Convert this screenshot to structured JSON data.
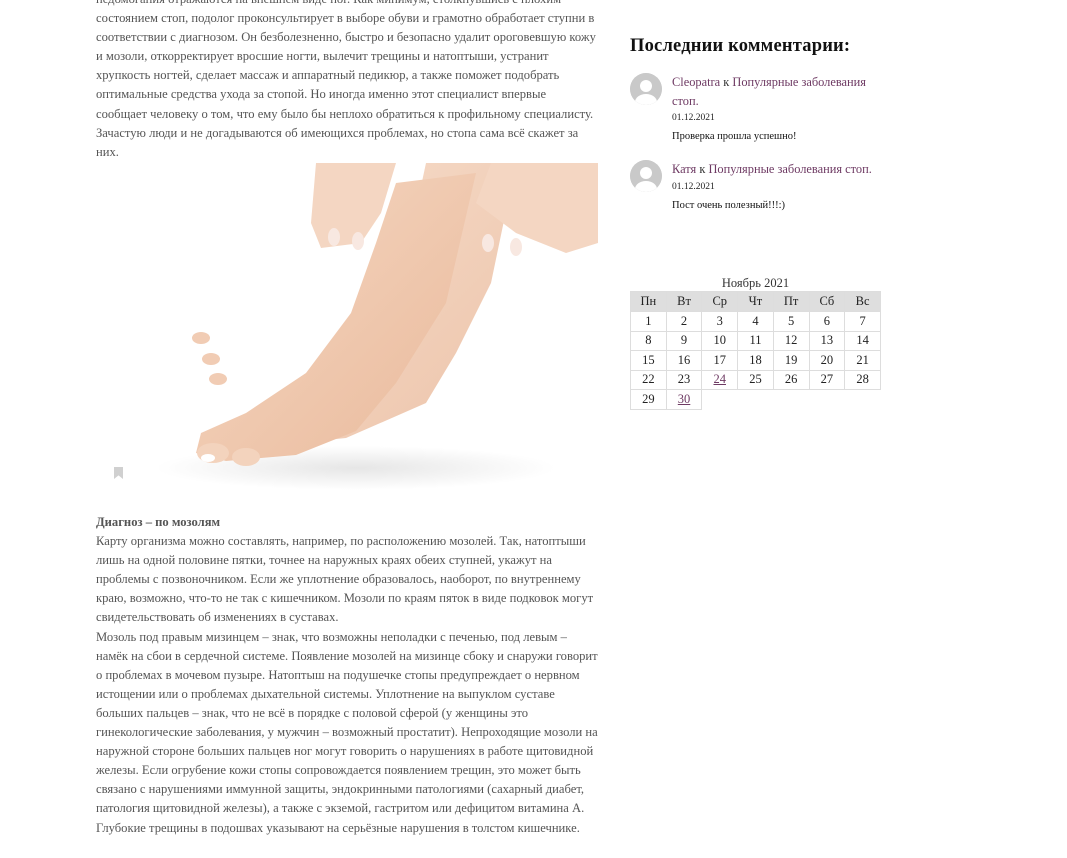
{
  "article": {
    "paragraph_top": "недомогания отражаются на внешнем виде ног. Как минимум, столкнувшись с плохим состоянием стоп, подолог проконсультирует в выборе обуви и грамотно обработает ступни в соответствии с диагнозом. Он безболезненно, быстро и безопасно удалит ороговевшую кожу и мозоли, откорректирует вросшие ногти, вылечит трещины и натоптыши, устранит хрупкость ногтей, сделает массаж и аппаратный педикюр, а также поможет подобрать оптимальные средства ухода за стопой. Но иногда именно этот специалист впервые сообщает человеку о том, что ему было бы неплохо обратиться к профильному специалисту. Зачастую люди и не догадываются об имеющихся проблемах, но стопа сама всё скажет за них.",
    "section_heading": "Диагноз – по мозолям",
    "paragraph_2": "Карту организма можно составлять, например, по расположению мозолей. Так, натоптыши лишь на одной половине пятки, точнее на наружных краях обеих ступней, укажут на проблемы с позвоночником. Если же уплотнение образовалось, наоборот, по внутреннему краю, возможно, что-то не так с кишечником. Мозоли по краям пяток в виде подковок могут свидетельствовать об изменениях в суставах.",
    "paragraph_3": "Мозоль под правым мизинцем – знак, что возможны неполадки с печенью, под левым – намёк на сбои в сердечной системе. Появление мозолей на мизинце сбоку и снаружи говорит о проблемах в мочевом пузыре. Натоптыш на подушечке стопы предупреждает о нервном истощении или о проблемах дыхательной системы. Уплотнение на выпуклом суставе больших пальцев – знак, что не всё в порядке с половой сферой (у женщины это гинекологические заболевания, у мужчин – возможный простатит). Непроходящие мозоли на наружной стороне больших пальцев ног могут говорить о нарушениях в работе щитовидной железы. Если огрубение кожи стопы сопровождается появлением трещин, это может быть связано с нарушениями иммунной защиты, эндокринными патологиями (сахарный диабет, патология щитовидной железы), а также с экземой, гастритом или дефицитом витамина А. Глубокие трещины в подошвах указывают на серьёзные нарушения в толстом кишечнике."
  },
  "sidebar": {
    "comments_title": "Последнии комментарии:",
    "comments": [
      {
        "author": "Cleopatra",
        "connector": " к ",
        "post": "Популярные заболевания стоп.",
        "date": "01.12.2021",
        "text": "Проверка прошла успешно!"
      },
      {
        "author": "Катя",
        "connector": " к ",
        "post": "Популярные заболевания стоп.",
        "date": "01.12.2021",
        "text": "Пост очень полезный!!!:)"
      }
    ]
  },
  "calendar": {
    "caption": "Ноябрь 2021",
    "weekdays": [
      "Пн",
      "Вт",
      "Ср",
      "Чт",
      "Пт",
      "Сб",
      "Вс"
    ],
    "weeks": [
      [
        "1",
        "2",
        "3",
        "4",
        "5",
        "6",
        "7"
      ],
      [
        "8",
        "9",
        "10",
        "11",
        "12",
        "13",
        "14"
      ],
      [
        "15",
        "16",
        "17",
        "18",
        "19",
        "20",
        "21"
      ],
      [
        "22",
        "23",
        "24",
        "25",
        "26",
        "27",
        "28"
      ],
      [
        "29",
        "30",
        "",
        "",
        "",
        "",
        ""
      ]
    ],
    "linked_days": [
      "24",
      "30"
    ],
    "link_color": "#6e3a63"
  },
  "colors": {
    "body_text": "#555555",
    "link": "#6e3a63",
    "calendar_header_bg": "#dedede"
  }
}
